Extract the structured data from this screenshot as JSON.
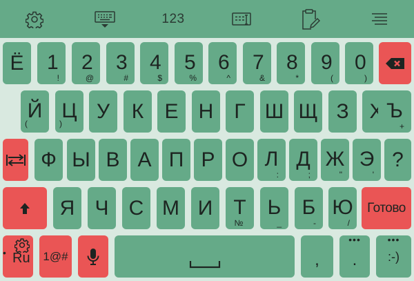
{
  "toolbar": {
    "number_label": "123",
    "icons": [
      "gear-icon",
      "keyboard-hide-icon",
      "text-edit-icon",
      "clipboard-edit-icon",
      "menu-icon"
    ]
  },
  "colors": {
    "background": "#d9e9e0",
    "key": "#65aa88",
    "accent_key": "#ea5555",
    "text": "#1d2421"
  },
  "rows": {
    "number_row": [
      {
        "main": "Ё",
        "sub": ""
      },
      {
        "main": "1",
        "sub": "!"
      },
      {
        "main": "2",
        "sub": "@"
      },
      {
        "main": "3",
        "sub": "#"
      },
      {
        "main": "4",
        "sub": "$"
      },
      {
        "main": "5",
        "sub": "%"
      },
      {
        "main": "6",
        "sub": "^"
      },
      {
        "main": "7",
        "sub": "&"
      },
      {
        "main": "8",
        "sub": "*"
      },
      {
        "main": "9",
        "sub": "("
      },
      {
        "main": "0",
        "sub": ")"
      }
    ],
    "row1": [
      {
        "main": "Й",
        "sub": "("
      },
      {
        "main": "Ц",
        "sub": ")"
      },
      {
        "main": "У",
        "sub": ""
      },
      {
        "main": "К",
        "sub": ""
      },
      {
        "main": "Е",
        "sub": ""
      },
      {
        "main": "Н",
        "sub": ""
      },
      {
        "main": "Г",
        "sub": ""
      },
      {
        "main": "Ш",
        "sub": ""
      },
      {
        "main": "Щ",
        "sub": ""
      },
      {
        "main": "З",
        "sub": ""
      },
      {
        "main": "Х",
        "sub": ""
      },
      {
        "main": "Ъ",
        "sub": "+"
      }
    ],
    "row2": [
      {
        "main": "Ф",
        "sub": ""
      },
      {
        "main": "Ы",
        "sub": ""
      },
      {
        "main": "В",
        "sub": ""
      },
      {
        "main": "А",
        "sub": ""
      },
      {
        "main": "П",
        "sub": ""
      },
      {
        "main": "Р",
        "sub": ""
      },
      {
        "main": "О",
        "sub": ""
      },
      {
        "main": "Л",
        "sub": ":"
      },
      {
        "main": "Д",
        "sub": ";"
      },
      {
        "main": "Ж",
        "sub": "\""
      },
      {
        "main": "Э",
        "sub": "'"
      },
      {
        "main": "?",
        "sub": ""
      }
    ],
    "row3": [
      {
        "main": "Я",
        "sub": ""
      },
      {
        "main": "Ч",
        "sub": ""
      },
      {
        "main": "С",
        "sub": ""
      },
      {
        "main": "М",
        "sub": ""
      },
      {
        "main": "И",
        "sub": ""
      },
      {
        "main": "Т",
        "sub": "№"
      },
      {
        "main": "Ь",
        "sub": "_"
      },
      {
        "main": "Б",
        "sub": "-"
      },
      {
        "main": "Ю",
        "sub": "/"
      }
    ]
  },
  "keys": {
    "done_label": "Готово",
    "lang_label": "Ru",
    "lang_dot": "•",
    "symbols_label": "1@#",
    "comma_label": ",",
    "period_label": ".",
    "smiley_label": ":-)",
    "popup_dots": "•••"
  }
}
